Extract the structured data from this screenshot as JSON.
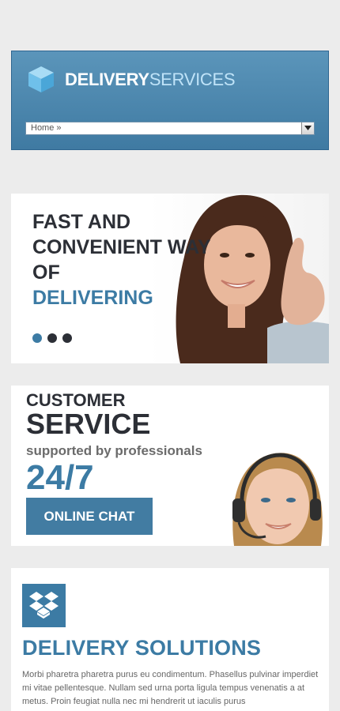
{
  "header": {
    "brand_bold": "DELIVERY",
    "brand_light": "SERVICES",
    "nav_value": "Home »",
    "logo_icon": "box-icon"
  },
  "hero": {
    "line1": "FAST AND",
    "line2": "CONVENIENT WAY",
    "line3": "OF",
    "line4": "DELIVERING",
    "slides": 3,
    "active_slide": 1
  },
  "service": {
    "line1": "CUSTOMER",
    "line2": "SERVICE",
    "line3": "supported by professionals",
    "line4": "24/7",
    "chat_button": "ONLINE CHAT"
  },
  "solutions": {
    "icon": "dropbox-icon",
    "title": "DELIVERY SOLUTIONS",
    "text": "Morbi pharetra pharetra purus eu condimentum. Phasellus pulvinar imperdiet mi vitae pellentesque. Nullam sed urna porta ligula tempus venenatis a at metus. Proin feugiat nulla nec mi hendrerit ut iaculis purus"
  },
  "colors": {
    "accent": "#3c7ba4",
    "dark_text": "#2c2f36",
    "background": "#ececec"
  }
}
